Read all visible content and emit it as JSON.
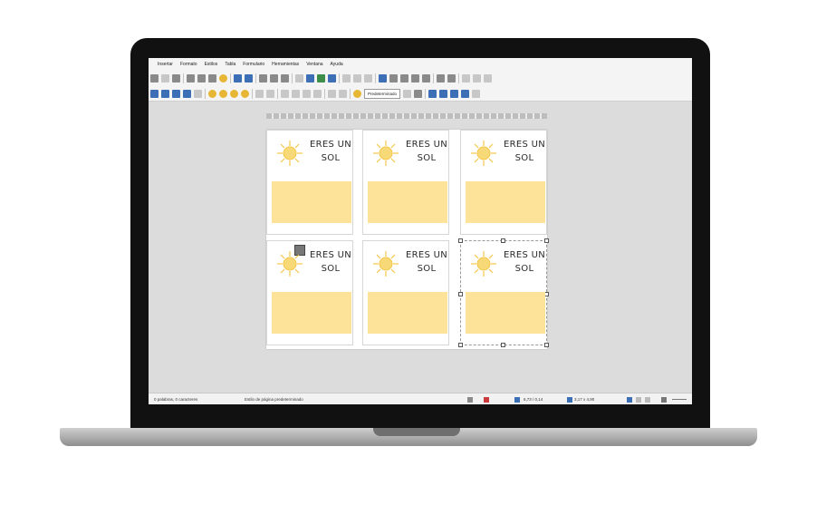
{
  "menu": [
    "Insertar",
    "Formato",
    "Estilos",
    "Tabla",
    "Formulario",
    "Herramientas",
    "Ventana",
    "Ayuda"
  ],
  "toolbar": {
    "paragraph_style": "Predeterminado"
  },
  "cards": [
    {
      "title_line1": "ERES UN",
      "title_line2": "SOL"
    },
    {
      "title_line1": "ERES UN",
      "title_line2": "SOL"
    },
    {
      "title_line1": "ERES UN",
      "title_line2": "SOL"
    },
    {
      "title_line1": "ERES UN",
      "title_line2": "SOL"
    },
    {
      "title_line1": "ERES UN",
      "title_line2": "SOL"
    },
    {
      "title_line1": "ERES UN",
      "title_line2": "SOL"
    }
  ],
  "colors": {
    "card_yellow": "#fde29a",
    "sun": "#f3c64a",
    "accent": "#3d6fb6"
  },
  "status": {
    "word_count": "0 palabras, 0 caracteres",
    "page_style": "Estilo de página predeterminado",
    "size1": "6,73 / 0,14",
    "size2": "3,17 x 4,90"
  }
}
